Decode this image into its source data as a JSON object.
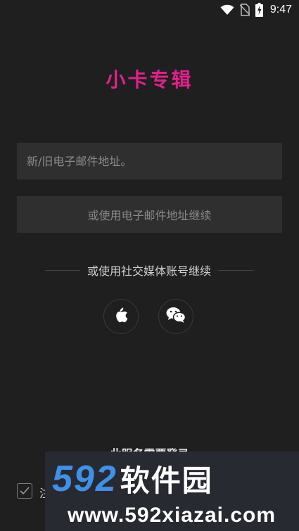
{
  "status_bar": {
    "time": "9:47",
    "icons": [
      "wifi-icon",
      "no-sim-icon",
      "battery-charging-icon"
    ]
  },
  "app": {
    "title": "小卡专辑"
  },
  "email": {
    "placeholder": "新/旧电子邮件地址。",
    "value": ""
  },
  "continue": {
    "label": "或使用电子邮件地址继续"
  },
  "social": {
    "divider_text": "或使用社交媒体账号继续",
    "buttons": [
      {
        "name": "apple",
        "icon": "apple-icon"
      },
      {
        "name": "wechat",
        "icon": "wechat-icon"
      }
    ]
  },
  "footer": {
    "login_hint": "此服务需要登录",
    "agree_text_visible": "注",
    "checkbox_checked": true
  },
  "watermark": {
    "brand_number": "592",
    "brand_text": "软件园",
    "url": "www.592xiazai.com"
  },
  "colors": {
    "background": "#1f1f1f",
    "title": "#e0218a",
    "input_bg": "#2f2f2f",
    "watermark_blue": "#3f90e8"
  }
}
